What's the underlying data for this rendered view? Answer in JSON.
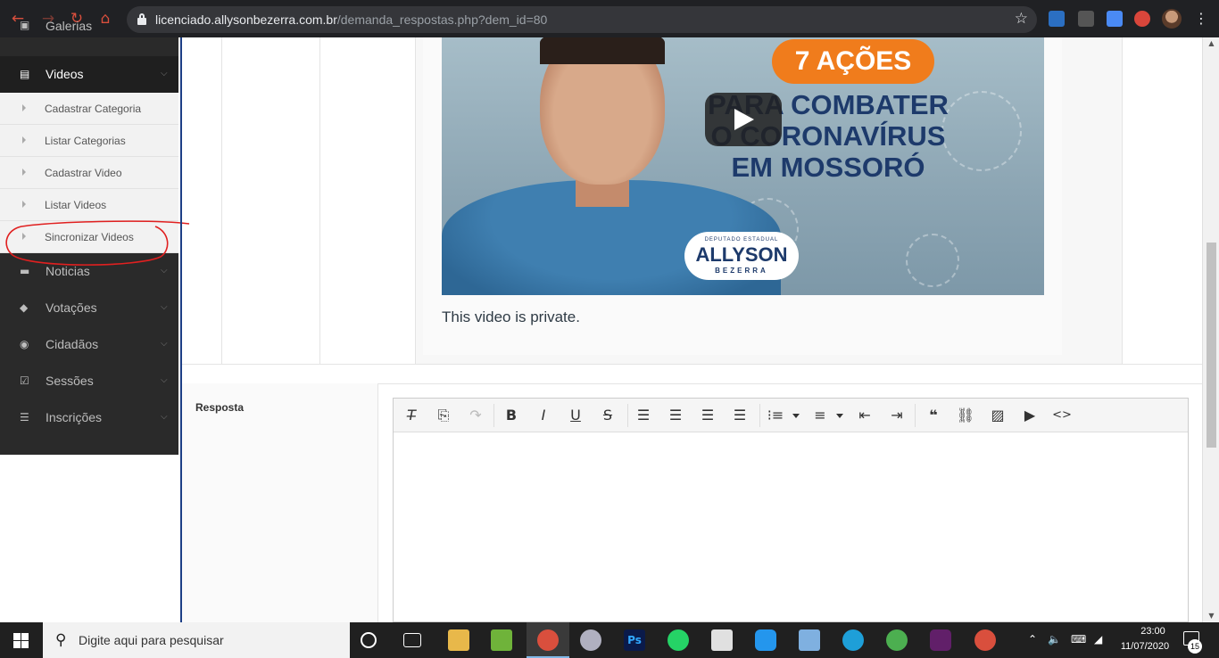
{
  "browser": {
    "url_host": "licenciado.allysonbezerra.com.br",
    "url_path": "/demanda_respostas.php?dem_id=80"
  },
  "sidebar": {
    "items": [
      {
        "label": "Galerias",
        "icon": "camera-icon"
      },
      {
        "label": "Videos",
        "icon": "film-icon"
      },
      {
        "label": "Noticias",
        "icon": "newspaper-icon"
      },
      {
        "label": "Votações",
        "icon": "tags-icon"
      },
      {
        "label": "Cidadãos",
        "icon": "eye-icon"
      },
      {
        "label": "Sessões",
        "icon": "checkbox-icon"
      },
      {
        "label": "Inscrições",
        "icon": "list-icon"
      }
    ],
    "subitems": [
      {
        "label": "Cadastrar Categoria"
      },
      {
        "label": "Listar Categorias"
      },
      {
        "label": "Cadastrar Video"
      },
      {
        "label": "Listar Videos"
      },
      {
        "label": "Sincronizar Videos"
      }
    ]
  },
  "video": {
    "pill": "7 AÇÕES",
    "headline_1": "PARA COMBATER",
    "headline_2": "O CORONAVÍRUS",
    "headline_3": "EM MOSSORÓ",
    "badge_small": "DEPUTADO ESTADUAL",
    "badge_name": "ALLYSON",
    "badge_surname": "BEZERRA",
    "status": "This video is private."
  },
  "form": {
    "resposta_label": "Resposta"
  },
  "taskbar": {
    "search_placeholder": "Digite aqui para pesquisar",
    "time": "23:00",
    "date": "11/07/2020",
    "notifications": "15"
  },
  "colors": {
    "sidebar_bg": "#2a2a2a",
    "accent_border": "#1d3f86",
    "pill_orange": "#f07c1c",
    "annotation_red": "#e02020"
  }
}
